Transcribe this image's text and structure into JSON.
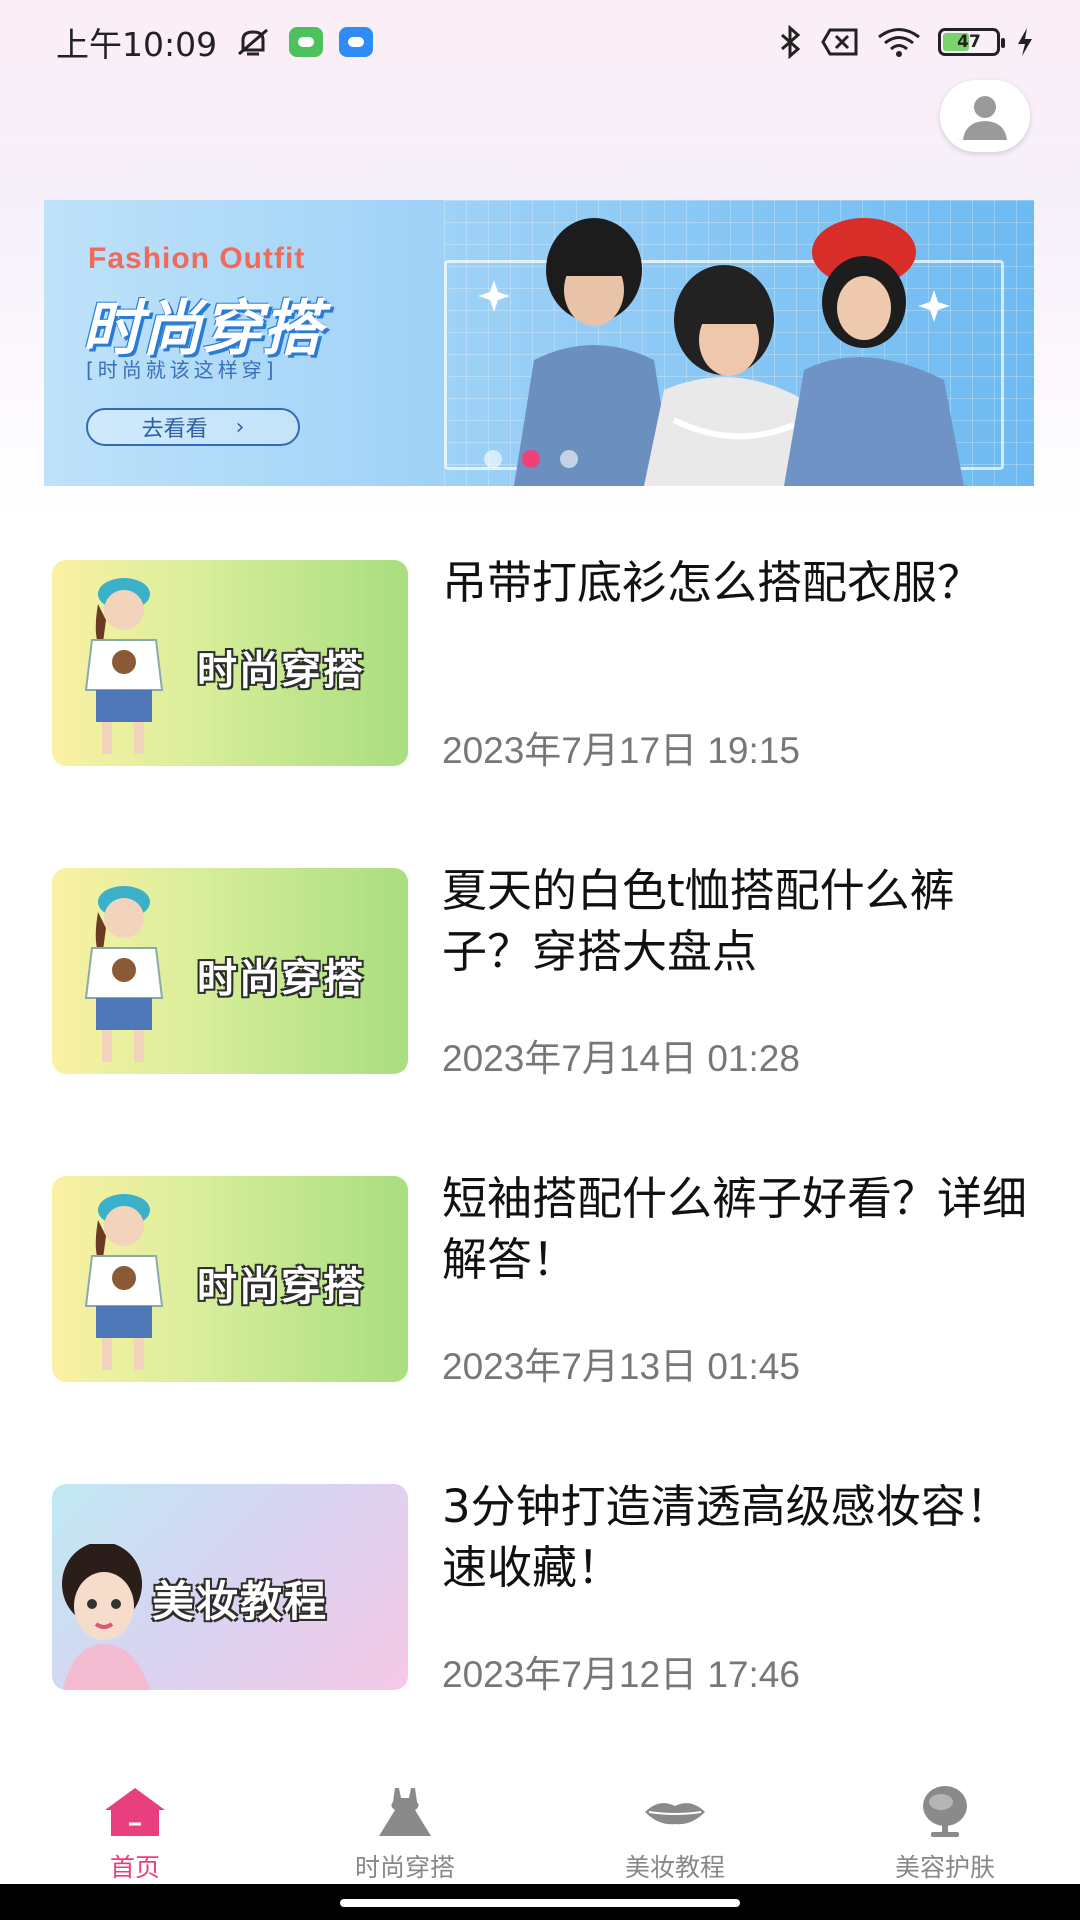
{
  "status_bar": {
    "time": "上午10:09",
    "battery": "47"
  },
  "banner": {
    "subtitle_en": "Fashion Outfit",
    "title": "时尚穿搭",
    "tagline": "[时尚就该这样穿]",
    "button_label": "去看看",
    "button_arrow": "›"
  },
  "articles": [
    {
      "thumb_label": "时尚穿搭",
      "title": "吊带打底衫怎么搭配衣服？",
      "time": "2023年7月17日 19:15"
    },
    {
      "thumb_label": "时尚穿搭",
      "title": "夏天的白色t恤搭配什么裤子？穿搭大盘点",
      "time": "2023年7月14日 01:28"
    },
    {
      "thumb_label": "时尚穿搭",
      "title": "短袖搭配什么裤子好看？详细解答！",
      "time": "2023年7月13日 01:45"
    },
    {
      "thumb_label": "美妆教程",
      "title": "3分钟打造清透高级感妆容！速收藏！",
      "time": "2023年7月12日 17:46"
    }
  ],
  "bottom_nav": [
    {
      "label": "首页",
      "icon": "home-icon",
      "active": true
    },
    {
      "label": "时尚穿搭",
      "icon": "dress-icon",
      "active": false
    },
    {
      "label": "美妆教程",
      "icon": "lips-icon",
      "active": false
    },
    {
      "label": "美容护肤",
      "icon": "mirror-icon",
      "active": false
    }
  ],
  "colors": {
    "accent": "#ea3f7e",
    "inactive": "#888888"
  }
}
